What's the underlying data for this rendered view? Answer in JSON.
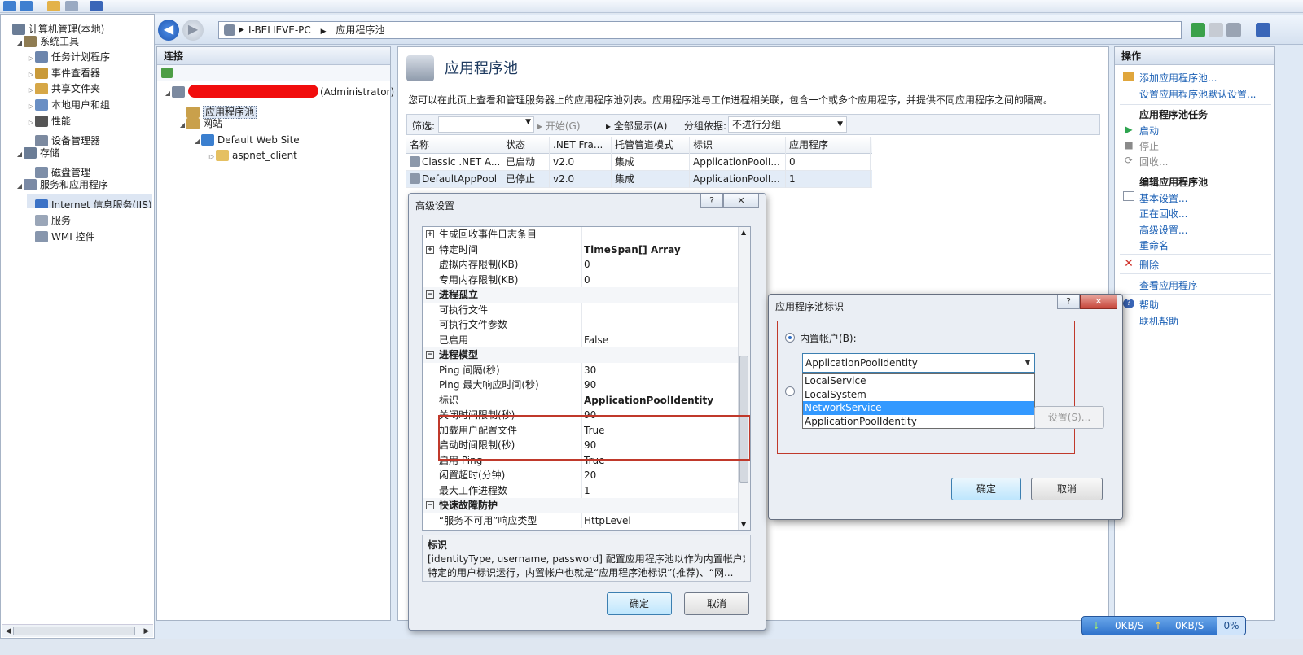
{
  "left_tree": {
    "items": [
      {
        "label": "计算机管理(本地)",
        "indent": 0,
        "icon": "computer-icon",
        "expander": ""
      },
      {
        "label": "系统工具",
        "indent": 1,
        "icon": "tools-icon",
        "expander": "◢"
      },
      {
        "label": "任务计划程序",
        "indent": 2,
        "icon": "clock-icon",
        "expander": "▷"
      },
      {
        "label": "事件查看器",
        "indent": 2,
        "icon": "event-icon",
        "expander": "▷"
      },
      {
        "label": "共享文件夹",
        "indent": 2,
        "icon": "folder-share-icon",
        "expander": "▷"
      },
      {
        "label": "本地用户和组",
        "indent": 2,
        "icon": "users-icon",
        "expander": "▷"
      },
      {
        "label": "性能",
        "indent": 2,
        "icon": "performance-icon",
        "expander": "▷"
      },
      {
        "label": "设备管理器",
        "indent": 2,
        "icon": "device-icon",
        "expander": ""
      },
      {
        "label": "存储",
        "indent": 1,
        "icon": "storage-icon",
        "expander": "◢"
      },
      {
        "label": "磁盘管理",
        "indent": 2,
        "icon": "disk-icon",
        "expander": ""
      },
      {
        "label": "服务和应用程序",
        "indent": 1,
        "icon": "services-apps-icon",
        "expander": "◢"
      },
      {
        "label": "Internet 信息服务(IIS)管",
        "indent": 2,
        "icon": "iis-icon",
        "expander": "",
        "selected": true
      },
      {
        "label": "服务",
        "indent": 2,
        "icon": "gear-icon",
        "expander": ""
      },
      {
        "label": "WMI 控件",
        "indent": 2,
        "icon": "wmi-icon",
        "expander": ""
      }
    ]
  },
  "address": {
    "server": "I-BELIEVE-PC",
    "page": "应用程序池"
  },
  "connections": {
    "title": "连接",
    "tree": [
      {
        "label": "(Administrator)",
        "indent": 0,
        "expander": "◢",
        "icon": "server-icon",
        "redacted": true
      },
      {
        "label": "应用程序池",
        "indent": 1,
        "expander": "",
        "icon": "app-pool-icon",
        "selected": true
      },
      {
        "label": "网站",
        "indent": 1,
        "expander": "◢",
        "icon": "sites-icon"
      },
      {
        "label": "Default Web Site",
        "indent": 2,
        "expander": "◢",
        "icon": "globe-icon"
      },
      {
        "label": "aspnet_client",
        "indent": 3,
        "expander": "▷",
        "icon": "folder-icon"
      }
    ]
  },
  "main": {
    "title": "应用程序池",
    "description": "您可以在此页上查看和管理服务器上的应用程序池列表。应用程序池与工作进程相关联，包含一个或多个应用程序，并提供不同应用程序之间的隔离。",
    "filter": {
      "label": "筛选:",
      "start": "开始(G)",
      "show_all": "全部显示(A)",
      "group_label": "分组依据:",
      "group_value": "不进行分组"
    },
    "columns": [
      "名称",
      "状态",
      ".NET Fra...",
      "托管管道模式",
      "标识",
      "应用程序"
    ],
    "rows": [
      [
        "Classic .NET A...",
        "已启动",
        "v2.0",
        "集成",
        "ApplicationPoolI...",
        "0"
      ],
      [
        "DefaultAppPool",
        "已停止",
        "v2.0",
        "集成",
        "ApplicationPoolI...",
        "1"
      ]
    ]
  },
  "actions": {
    "title": "操作",
    "add_pool": "添加应用程序池...",
    "set_defaults": "设置应用程序池默认设置...",
    "tasks_header": "应用程序池任务",
    "start": "启动",
    "stop": "停止",
    "recycle": "回收...",
    "edit_header": "编辑应用程序池",
    "basic": "基本设置...",
    "recycling": "正在回收...",
    "advanced": "高级设置...",
    "rename": "重命名",
    "delete": "删除",
    "view_apps": "查看应用程序",
    "help": "帮助",
    "online_help": "联机帮助"
  },
  "advanced_dialog": {
    "title": "高级设置",
    "help_btn": "?",
    "close_btn": "✕",
    "rows": [
      {
        "name": "生成回收事件日志条目",
        "value": "",
        "type": "expand"
      },
      {
        "name": "特定时间",
        "value": "TimeSpan[] Array",
        "type": "expand",
        "bold": true
      },
      {
        "name": "虚拟内存限制(KB)",
        "value": "0",
        "type": "item"
      },
      {
        "name": "专用内存限制(KB)",
        "value": "0",
        "type": "item"
      },
      {
        "name": "进程孤立",
        "value": "",
        "type": "category"
      },
      {
        "name": "可执行文件",
        "value": "",
        "type": "item"
      },
      {
        "name": "可执行文件参数",
        "value": "",
        "type": "item"
      },
      {
        "name": "已启用",
        "value": "False",
        "type": "item"
      },
      {
        "name": "进程模型",
        "value": "",
        "type": "category"
      },
      {
        "name": "Ping 间隔(秒)",
        "value": "30",
        "type": "item"
      },
      {
        "name": "Ping 最大响应时间(秒)",
        "value": "90",
        "type": "item"
      },
      {
        "name": "标识",
        "value": "ApplicationPoolIdentity",
        "type": "item",
        "bold": true
      },
      {
        "name": "关闭时间限制(秒)",
        "value": "90",
        "type": "item"
      },
      {
        "name": "加载用户配置文件",
        "value": "True",
        "type": "item"
      },
      {
        "name": "启动时间限制(秒)",
        "value": "90",
        "type": "item"
      },
      {
        "name": "启用 Ping",
        "value": "True",
        "type": "item"
      },
      {
        "name": "闲置超时(分钟)",
        "value": "20",
        "type": "item"
      },
      {
        "name": "最大工作进程数",
        "value": "1",
        "type": "item"
      },
      {
        "name": "快速故障防护",
        "value": "",
        "type": "category"
      },
      {
        "name": "“服务不可用”响应类型",
        "value": "HttpLevel",
        "type": "item"
      }
    ],
    "desc_title": "标识",
    "desc_line1": "[identityType, username, password] 配置应用程序池以作为内置帐户或",
    "desc_line2": "特定的用户标识运行，内置帐户也就是“应用程序池标识”(推荐)、“网...",
    "ok": "确定",
    "cancel": "取消"
  },
  "identity_dialog": {
    "title": "应用程序池标识",
    "help_btn": "?",
    "close_btn": "✕",
    "builtin_label": "内置帐户(B):",
    "selected": "ApplicationPoolIdentity",
    "options": [
      "LocalService",
      "LocalSystem",
      "NetworkService",
      "ApplicationPoolIdentity"
    ],
    "highlighted_option": "NetworkService",
    "set_button": "设置(S)...",
    "ok": "确定",
    "cancel": "取消"
  },
  "net_widget": {
    "down": "0KB/S",
    "up": "0KB/S",
    "percent": "0%"
  }
}
